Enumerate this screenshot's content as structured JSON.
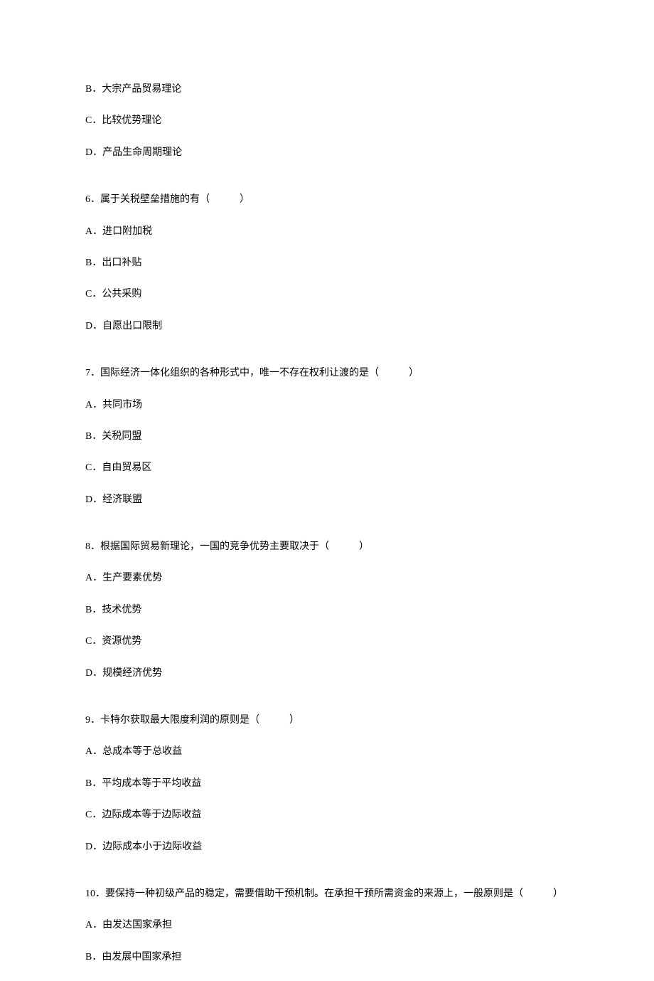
{
  "leading_options": [
    "B．大宗产品贸易理论",
    "C．比较优势理论",
    "D．产品生命周期理论"
  ],
  "questions": [
    {
      "stem": "6．属于关税壁垒措施的有（　　　）",
      "options": [
        "A．进口附加税",
        "B．出口补贴",
        "C．公共采购",
        "D．自愿出口限制"
      ]
    },
    {
      "stem": "7．国际经济一体化组织的各种形式中，唯一不存在权利让渡的是（　　　）",
      "options": [
        "A．共同市场",
        "B．关税同盟",
        "C．自由贸易区",
        "D．经济联盟"
      ]
    },
    {
      "stem": "8．根据国际贸易新理论，一国的竞争优势主要取决于（　　　）",
      "options": [
        "A．生产要素优势",
        "B．技术优势",
        "C．资源优势",
        "D．规模经济优势"
      ]
    },
    {
      "stem": "9．卡特尔获取最大限度利润的原则是（　　　）",
      "options": [
        "A．总成本等于总收益",
        "B．平均成本等于平均收益",
        "C．边际成本等于边际收益",
        "D．边际成本小于边际收益"
      ]
    },
    {
      "stem": "10．要保持一种初级产品的稳定，需要借助干预机制。在承担干预所需资金的来源上，一般原则是（　　　）",
      "options": [
        "A．由发达国家承担",
        "B．由发展中国家承担"
      ]
    }
  ]
}
